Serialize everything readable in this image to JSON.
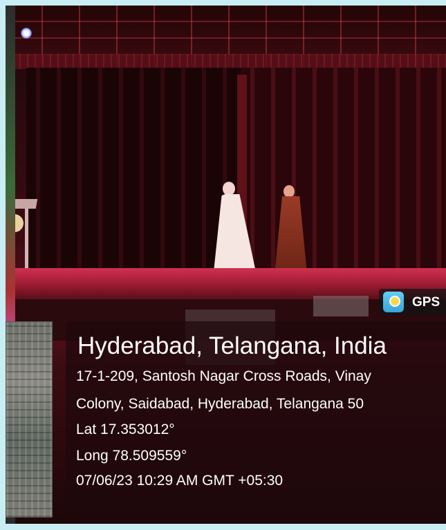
{
  "gps_badge": {
    "label": "GPS",
    "icon": "gps-map-camera-icon"
  },
  "location": {
    "city": "Hyderabad, Telangana, India",
    "address_line1": "17-1-209, Santosh Nagar Cross Roads, Vinay",
    "address_line2": "Colony, Saidabad, Hyderabad, Telangana 50",
    "lat": "Lat 17.353012°",
    "long": "Long 78.509559°",
    "datetime": "07/06/23 10:29 AM GMT +05:30"
  },
  "colors": {
    "stage_red": "#c0304a",
    "overlay": "#1e080c",
    "frame": "#c8eef3"
  }
}
